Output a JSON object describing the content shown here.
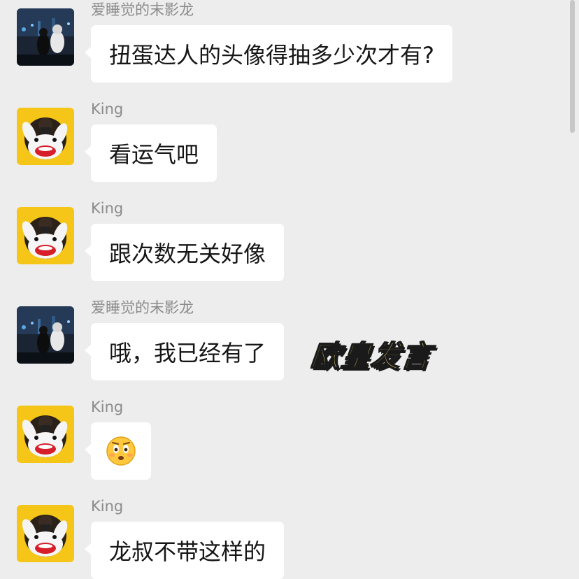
{
  "messages": [
    {
      "sender": "爱睡觉的末影龙",
      "text": "扭蛋达人的头像得抽多少次才有?",
      "avatar": "night-city-avatar"
    },
    {
      "sender": "King",
      "text": "看运气吧",
      "avatar": "cartoon-rabbit-avatar"
    },
    {
      "sender": "King",
      "text": "跟次数无关好像",
      "avatar": "cartoon-rabbit-avatar"
    },
    {
      "sender": "爱睡觉的末影龙",
      "text": "哦，我已经有了",
      "avatar": "night-city-avatar"
    },
    {
      "sender": "King",
      "text": "",
      "emoji": "squinting-emoji",
      "avatar": "cartoon-rabbit-avatar"
    },
    {
      "sender": "King",
      "text": "龙叔不带这样的",
      "avatar": "cartoon-rabbit-avatar"
    }
  ],
  "sticker": {
    "text": "欧皇发言"
  },
  "colors": {
    "background": "#ededed",
    "bubble": "#ffffff",
    "sender_name": "#8b8b8b",
    "sticker_fill": "#f3d86a",
    "avatar_yellow": "#f5c518"
  }
}
